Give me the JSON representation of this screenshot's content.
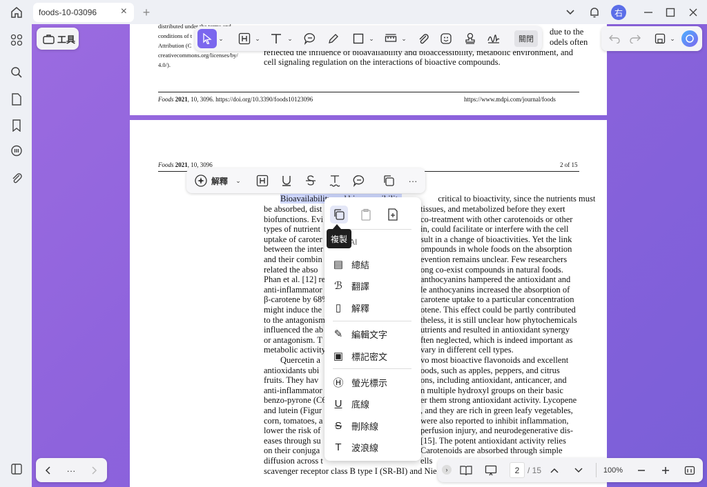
{
  "tab": {
    "title": "foods-10-03096"
  },
  "user": {
    "avatar": "右"
  },
  "tools": {
    "label": "工具",
    "close_label": "關閉"
  },
  "page1": {
    "license_lines": [
      "distributed under the terms and",
      "conditions of t",
      "Attribution (C",
      "creativecommons.org/licenses/by/",
      "4.0/)."
    ],
    "body_right": [
      "due to the",
      "odels often"
    ],
    "body": [
      "reflected the influence of bioavailability and bioaccessibility, metabolic environment, and",
      "cell signaling regulation on the interactions of bioactive compounds."
    ],
    "footer_left_italic": "Foods",
    "footer_left_bold": "2021",
    "footer_left_rest": ", 10, 3096. https://doi.org/10.3390/foods10123096",
    "footer_right": "https://www.mdpi.com/journal/foods"
  },
  "page2": {
    "header_italic": "Foods",
    "header_bold": "2021",
    "header_rest": ", 10, 3096",
    "page_label": "2 of 15",
    "line1_highlight": "Bioavailability and bioaccessibility",
    "line1_rest": "critical to bioactivity, since the nutrients must",
    "left_col": [
      "be absorbed, dist",
      "biofunctions. Evi",
      "types of nutrient",
      "uptake of caroter",
      "between the inter",
      "and their combin",
      "related the abso",
      "Phan et al. [12] re",
      "anti-inflammator",
      "β-carotene by 68%",
      "might induce the",
      "to the antagonism",
      "influenced the ab",
      "or antagonism. T",
      "metabolic activity",
      "Quercetin a",
      "antioxidants ubi",
      "fruits.  They hav",
      "anti-inflammator",
      "benzo-pyrone (C6",
      "and lutein (Figur",
      "corn, tomatoes, a",
      "lower the risk of",
      "eases through su",
      "on their conjuga",
      "diffusion across t"
    ],
    "right_col": [
      "tissues, and metabolized before they exert",
      "co-treatment with other carotenoids or other",
      "in, could facilitate or interfere with the cell",
      "sult in a change of bioactivities. Yet the link",
      "ompounds in whole foods on the absorption",
      "evention remains unclear.  Few researchers",
      "ong co-exist compounds in natural foods.",
      "anthocyanins hampered the antioxidant and",
      "le anthocyanins increased the absorption of",
      "carotene uptake to a particular concentration",
      "otene. This effect could be partly contributed",
      "theless, it is still unclear how phytochemicals",
      "utrients and resulted in antioxidant synergy",
      "ften neglected, which is indeed important as",
      "vary in different cell types.",
      "vo most bioactive flavonoids and excellent",
      "oods, such as apples, peppers, and citrus",
      "ons, including antioxidant, anticancer, and",
      "n multiple hydroxyl groups on their basic",
      "er them strong antioxidant activity. Lycopene",
      ", and they are rich in green leafy vegetables,",
      "were also reported to inhibit inflammation,",
      "perfusion injury, and neurodegenerative dis-",
      "[15].  The potent antioxidant activity relies",
      "Carotenoids are absorbed through simple",
      "ells"
    ],
    "last_line": "scavenger receptor class B type I (SR-BI) and Nie"
  },
  "float_bar": {
    "ai_label": "解釋"
  },
  "menu": {
    "tooltip": "複製",
    "ai_label": "AI",
    "items": [
      "總結",
      "翻譯",
      "解釋",
      "編輯文字",
      "標記密文",
      "螢光標示",
      "底線",
      "刪除線",
      "波浪線"
    ]
  },
  "bottom": {
    "page_current": "2",
    "page_total": "/ 15",
    "zoom": "100%",
    "more": "···"
  },
  "colors": {
    "accent": "#7b67ee",
    "highlight": "#cfd8ff",
    "canvas": "#8e63dc"
  }
}
